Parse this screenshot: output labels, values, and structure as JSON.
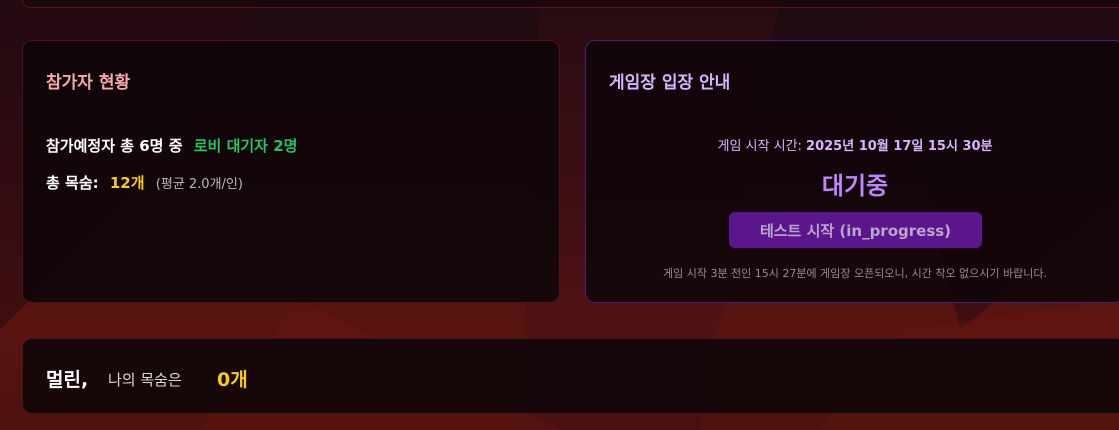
{
  "participants": {
    "title": "참가자 현황",
    "summary_prefix": "참가예정자 총 6명 중",
    "lobby_waiting": "로비 대기자 2명",
    "total_lives_label": "총 목숨:",
    "total_lives_value": "12개",
    "average": "(평균 2.0개/인)"
  },
  "entry": {
    "title": "게임장 입장 안내",
    "start_label": "게임 시작 시간:",
    "start_time": "2025년 10월 17일 15시 30분",
    "status": "대기중",
    "test_button_label": "테스트 시작 (in_progress)",
    "notice": "게임 시작 3분 전인 15시 27분에 게임장 오픈되오니, 시간 착오 없으시기 바랍니다."
  },
  "user": {
    "name": "멀린,",
    "lives_label": "나의 목숨은",
    "lives_value": "0개"
  },
  "colors": {
    "background_red": "#5a1410",
    "card_bg": "#0e0609",
    "accent_purple": "#c084fc",
    "button_purple": "#5b168e",
    "highlight_green": "#22c55e",
    "highlight_gold": "#facc15",
    "title_pink": "#f8a8a8"
  }
}
